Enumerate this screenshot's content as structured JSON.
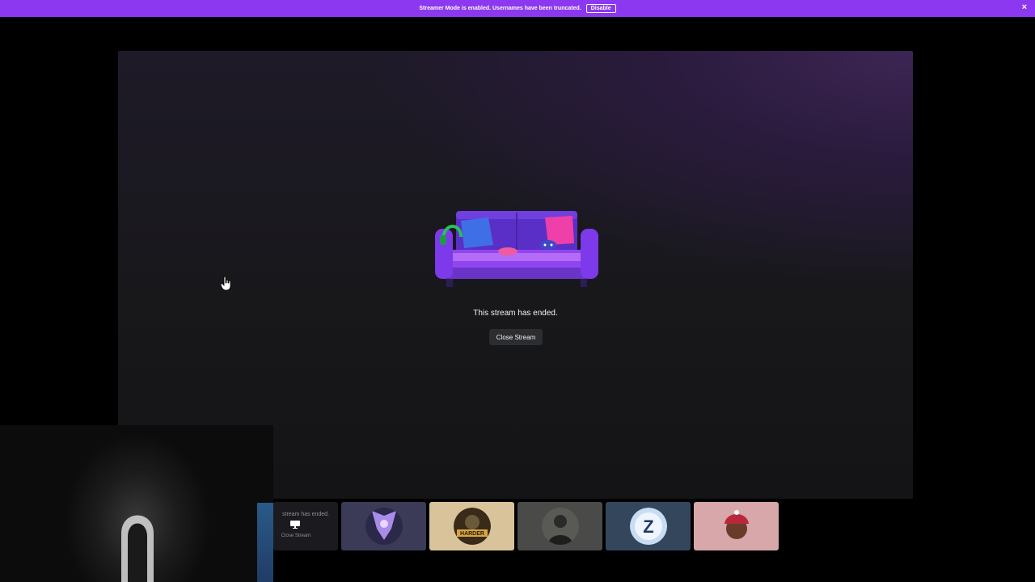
{
  "banner": {
    "message": "Streamer Mode is enabled. Usernames have been truncated.",
    "disable_label": "Disable",
    "close_icon": "×"
  },
  "stream": {
    "ended_message": "This stream has ended.",
    "close_label": "Close Stream"
  },
  "participants": {
    "self_tile": {
      "ended_message": "stream has ended.",
      "close_label": "Close Stream"
    },
    "tiles": [
      {
        "name": "participant-1-avatar"
      },
      {
        "name": "participant-2-avatar"
      },
      {
        "name": "participant-3-avatar"
      },
      {
        "name": "participant-4-avatar"
      },
      {
        "name": "participant-5-avatar"
      }
    ],
    "tile_2_logo_text": "HARDER",
    "tile_4_logo_text": "Z"
  },
  "colors": {
    "banner": "#8b38f0",
    "panel_dark": "#18181b",
    "panel_purple": "#3d2554",
    "button_bg": "#2b2d31"
  }
}
